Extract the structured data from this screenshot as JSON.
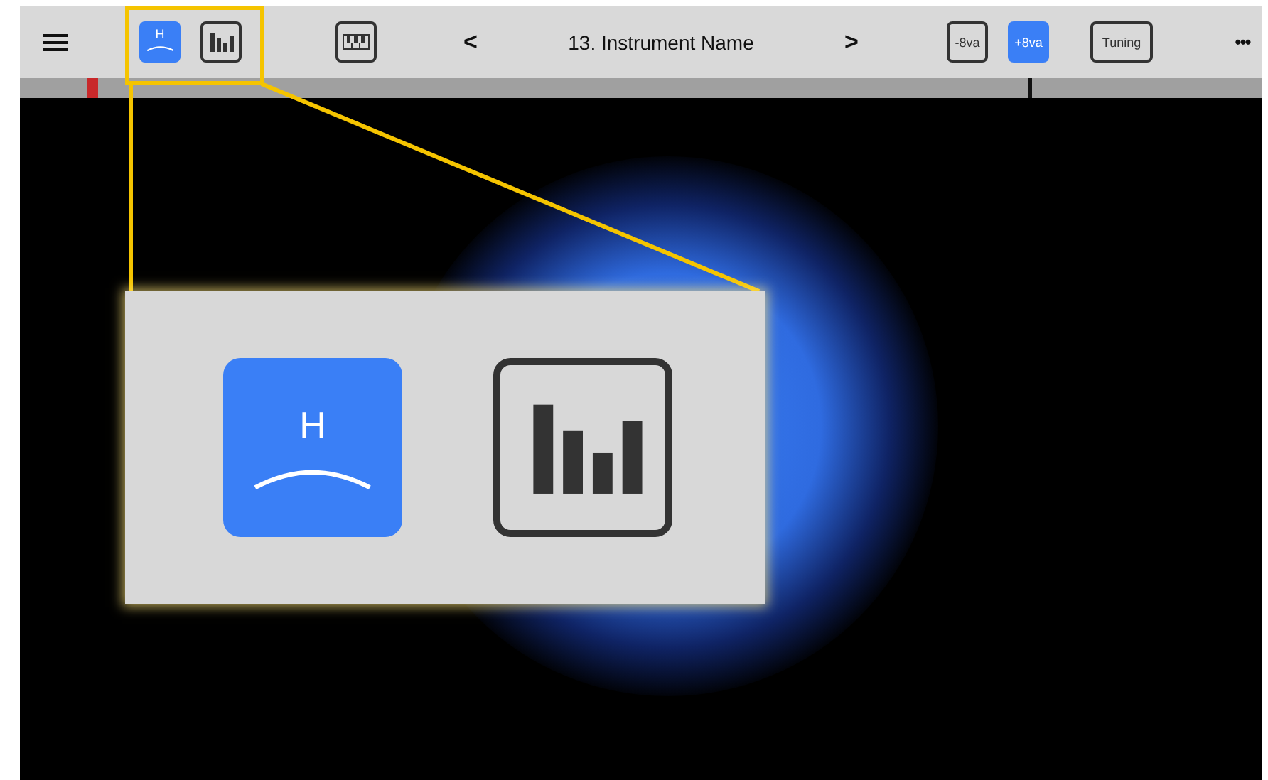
{
  "toolbar": {
    "items": [
      {
        "kind": "menu"
      },
      {
        "kind": "harmonic",
        "label": "H",
        "selected": true
      },
      {
        "kind": "bars",
        "selected": false
      },
      {
        "kind": "piano"
      },
      {
        "kind": "prev",
        "label": "<"
      },
      {
        "kind": "title",
        "label": "13. Instrument Name"
      },
      {
        "kind": "next",
        "label": ">"
      },
      {
        "kind": "octave",
        "label": "-8va",
        "selected": false
      },
      {
        "kind": "octave",
        "label": "+8va",
        "selected": true
      },
      {
        "kind": "tuning",
        "label": "Tuning"
      },
      {
        "kind": "more",
        "label": "•••"
      }
    ]
  },
  "callout": {
    "items": [
      {
        "kind": "harmonic",
        "label": "H",
        "selected": true
      },
      {
        "kind": "bars",
        "selected": false
      }
    ]
  }
}
